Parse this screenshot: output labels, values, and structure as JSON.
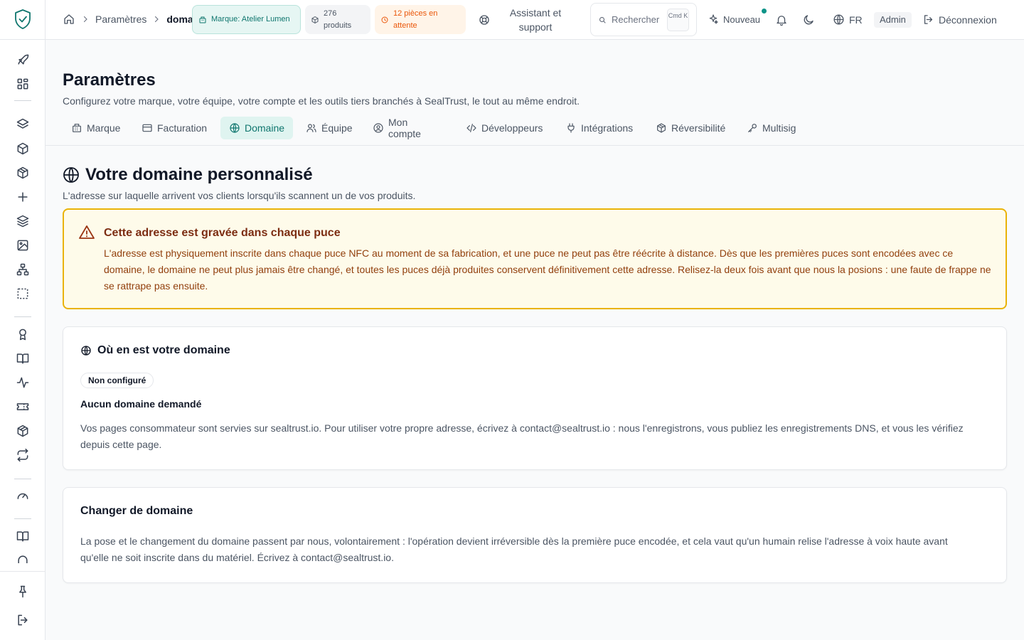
{
  "breadcrumb": {
    "parent": "Paramètres",
    "current": "domain"
  },
  "topbar": {
    "brand_pill": "Marque: Atelier Lumen",
    "products_pill": "276 produits",
    "pending_pill": "12 pièces en attente",
    "support_label": "Assistant et support",
    "search": {
      "placeholder": "Rechercher",
      "shortcut": "Cmd K"
    },
    "new_label": "Nouveau",
    "language": "FR",
    "role_badge": "Admin",
    "logout_label": "Déconnexion"
  },
  "page": {
    "title": "Paramètres",
    "subtitle": "Configurez votre marque, votre équipe, votre compte et les outils tiers branchés à SealTrust, le tout au même endroit."
  },
  "tabs": [
    {
      "label": "Marque",
      "icon": "building-icon",
      "active": false
    },
    {
      "label": "Facturation",
      "icon": "credit-card-icon",
      "active": false
    },
    {
      "label": "Domaine",
      "icon": "globe-icon",
      "active": true
    },
    {
      "label": "Équipe",
      "icon": "users-icon",
      "active": false
    },
    {
      "label": "Mon compte",
      "icon": "user-circle-icon",
      "active": false
    },
    {
      "label": "Développeurs",
      "icon": "code-icon",
      "active": false
    },
    {
      "label": "Intégrations",
      "icon": "plug-icon",
      "active": false
    },
    {
      "label": "Réversibilité",
      "icon": "package-icon",
      "active": false
    },
    {
      "label": "Multisig",
      "icon": "key-icon",
      "active": false
    }
  ],
  "domain_section": {
    "title": "Votre domaine personnalisé",
    "subtitle": "L'adresse sur laquelle arrivent vos clients lorsqu'ils scannent un de vos produits."
  },
  "warning": {
    "title": "Cette adresse est gravée dans chaque puce",
    "body": "L'adresse est physiquement inscrite dans chaque puce NFC au moment de sa fabrication, et une puce ne peut pas être réécrite à distance. Dès que les premières puces sont encodées avec ce domaine, le domaine ne peut plus jamais être changé, et toutes les puces déjà produites conservent définitivement cette adresse. Relisez-la deux fois avant que nous la posions : une faute de frappe ne se rattrape pas ensuite."
  },
  "status_card": {
    "title": "Où en est votre domaine",
    "badge": "Non configuré",
    "status_text": "Aucun domaine demandé",
    "body": "Vos pages consommateur sont servies sur sealtrust.io. Pour utiliser votre propre adresse, écrivez à contact@sealtrust.io : nous l'enregistrons, vous publiez les enregistrements DNS, et vous les vérifiez depuis cette page."
  },
  "change_card": {
    "title": "Changer de domaine",
    "body": "La pose et le changement du domaine passent par nous, volontairement : l'opération devient irréversible dès la première puce encodée, et cela vaut qu'un humain relise l'adresse à voix haute avant qu'elle ne soit inscrite dans du matériel. Écrivez à contact@sealtrust.io."
  },
  "sidebar_icons": [
    "rocket-icon",
    "dashboard-icon",
    "layers-icon",
    "box-icon",
    "package-icon",
    "plus-icon",
    "stack-icon",
    "image-icon",
    "network-icon",
    "selection-icon",
    "award-icon",
    "book-open-icon",
    "activity-icon",
    "ticket-icon",
    "cube-icon",
    "repeat-icon",
    "gauge-icon",
    "book-icon",
    "magnet-icon",
    "pin-icon",
    "logout-icon"
  ],
  "colors": {
    "accent": "#0f766e",
    "accent_bg": "#dff4f0",
    "warning_border": "#eab308",
    "warning_bg": "#fefbea",
    "pending": "#ea580c"
  }
}
